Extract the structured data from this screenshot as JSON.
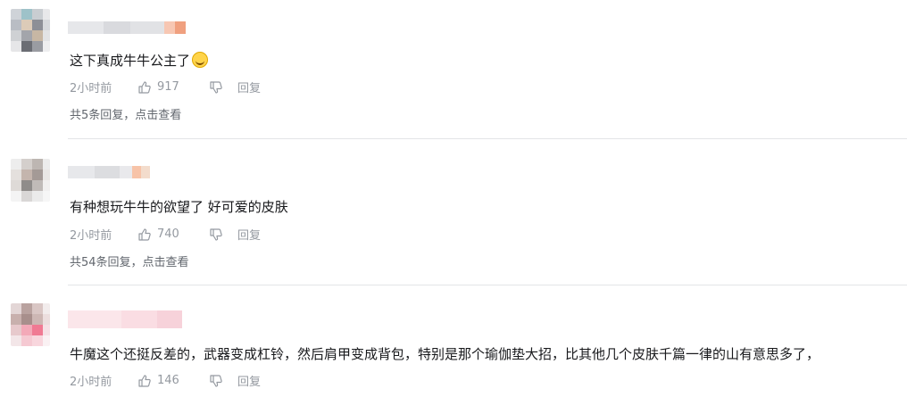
{
  "comments": [
    {
      "text": "这下真成牛牛公主了",
      "emoji": "laughing-emoji",
      "time": "2小时前",
      "likes": "917",
      "reply_label": "回复",
      "replies_text": "共5条回复，点击查看"
    },
    {
      "text": "有种想玩牛牛的欲望了 好可爱的皮肤",
      "time": "2小时前",
      "likes": "740",
      "reply_label": "回复",
      "replies_text": "共54条回复，点击查看"
    },
    {
      "text": "牛魔这个还挺反差的，武器变成杠铃，然后肩甲变成背包，特别是那个瑜伽垫大招，比其他几个皮肤千篇一律的山有意思多了，",
      "time": "2小时前",
      "likes": "146",
      "reply_label": "回复"
    }
  ],
  "colors": {
    "text": "#18191c",
    "meta": "#9499a0",
    "divider": "#e3e5e7"
  }
}
